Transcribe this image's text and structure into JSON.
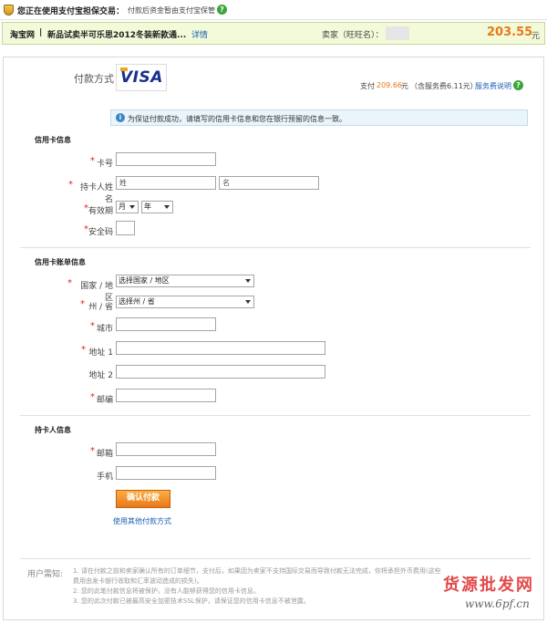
{
  "topbar": {
    "title": "您正在使用支付宝担保交易：",
    "subtitle": "付款后资金暂由支付宝保管",
    "help": "?"
  },
  "order": {
    "site": "淘宝网",
    "item": "新品试卖半可乐思2012冬装新款通...",
    "details_link": "详情",
    "seller_label": "卖家（旺旺名）：",
    "amount": "203.55",
    "currency": "元"
  },
  "payment": {
    "method_label": "付款方式",
    "brand": "VISA",
    "pay_label": "支付",
    "pay_amount": "209.66",
    "pay_unit": "元",
    "fee_note": "（含服务费6.11元）",
    "fee_link": "服务费说明",
    "help": "?"
  },
  "notice": {
    "icon": "i",
    "text": "为保证付款成功，请填写的信用卡信息和您在银行预留的信息一致。"
  },
  "card_section": {
    "title": "信用卡信息",
    "card_number_label": "卡号",
    "holder_label": "持卡人姓名",
    "first_name_placeholder": "姓",
    "last_name_placeholder": "名",
    "expiry_label": "有效期",
    "month": "月",
    "year": "年",
    "cvv_label": "安全码"
  },
  "billing_section": {
    "title": "信用卡账单信息",
    "country_label": "国家 / 地区",
    "country_value": "选择国家 / 地区",
    "state_label": "州 / 省",
    "state_value": "选择州 / 省",
    "city_label": "城市",
    "address1_label": "地址 1",
    "address2_label": "地址 2",
    "zip_label": "邮编"
  },
  "holder_section": {
    "title": "持卡人信息",
    "email_label": "邮箱",
    "phone_label": "手机"
  },
  "actions": {
    "confirm": "确认付款",
    "other_methods": "使用其他付款方式"
  },
  "notes": {
    "title": "用户需知:",
    "items": [
      "1. 请在付款之前和卖家确认所有的订单细节，支付后，如果因为卖家不支持国际交易而导致付款无法完成，你将承担外币费用(这些费用由发卡银行收取和汇率波动造成的损失)。",
      "2. 您的此笔付款信息将被保护，没有人能够获得您的信用卡信息。",
      "3. 您的此次付款已被最高安全加密技术SSL保护，请保证您的信用卡信息不被泄露。"
    ]
  },
  "watermark": {
    "cn": "货源批发网",
    "url": "www.6pf.cn"
  },
  "colors": {
    "accent_orange": "#e8781a",
    "link_blue": "#1a5fb4",
    "required_red": "#e02020"
  }
}
